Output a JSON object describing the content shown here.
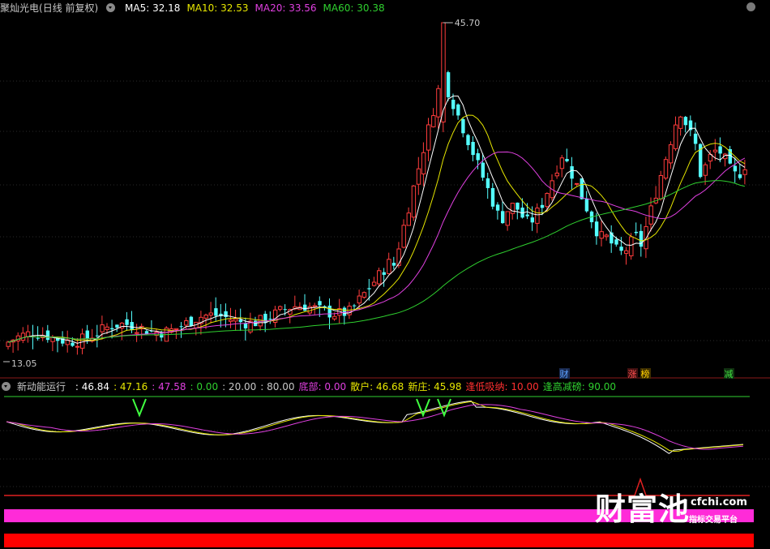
{
  "main_header": {
    "stock": "聚灿光电",
    "period": "(日线 前复权)",
    "ma": [
      {
        "label": "MA5: 32.18",
        "color": "#ffffff"
      },
      {
        "label": "MA10: 32.53",
        "color": "#e6e600"
      },
      {
        "label": "MA20: 33.56",
        "color": "#e040e0"
      },
      {
        "label": "MA60: 30.38",
        "color": "#2fd02f"
      }
    ]
  },
  "main_annotations": {
    "high_label": "45.70",
    "low_label": "13.05",
    "markers": [
      {
        "text": "财",
        "color": "#5aa0ff",
        "bg": "#1a2a50"
      },
      {
        "text": "涨",
        "color": "#ff5050",
        "bg": "#401010"
      },
      {
        "text": "榜",
        "color": "#ffd000",
        "bg": "#403000"
      },
      {
        "text": "减",
        "color": "#40e040",
        "bg": "#103010"
      }
    ]
  },
  "sub_header": {
    "name": "新动能运行",
    "items": [
      {
        "label": ": 46.84",
        "color": "#ffffff"
      },
      {
        "label": ": 47.16",
        "color": "#e6e600"
      },
      {
        "label": ": 47.58",
        "color": "#e040e0"
      },
      {
        "label": ": 0.00",
        "color": "#2fd02f"
      },
      {
        "label": ": 20.00",
        "color": "#c8c8c8"
      },
      {
        "label": ": 80.00",
        "color": "#c8c8c8"
      },
      {
        "label": "底部: 0.00",
        "color": "#e040e0"
      },
      {
        "label": "散户: 46.68",
        "color": "#e6e600"
      },
      {
        "label": "新庄: 45.98",
        "color": "#e6e600"
      },
      {
        "label": "逢低吸纳: 10.00",
        "color": "#ff3030"
      },
      {
        "label": "逢高减磅: 90.00",
        "color": "#2fd02f"
      }
    ]
  },
  "watermark": {
    "big": "财富池",
    "url": "cfchi.com",
    "sub": "指标交易平台"
  },
  "colors": {
    "up": "#ff3c3c",
    "down": "#54ffff",
    "ma5": "#ffffff",
    "ma10": "#e6e600",
    "ma20": "#e040e0",
    "ma60": "#2fd02f",
    "grid": "#2a2a2a",
    "separator": "#b02020"
  },
  "chart_data": {
    "type": "candlestick",
    "price_range": [
      13.05,
      45.7
    ],
    "candles": []
  }
}
